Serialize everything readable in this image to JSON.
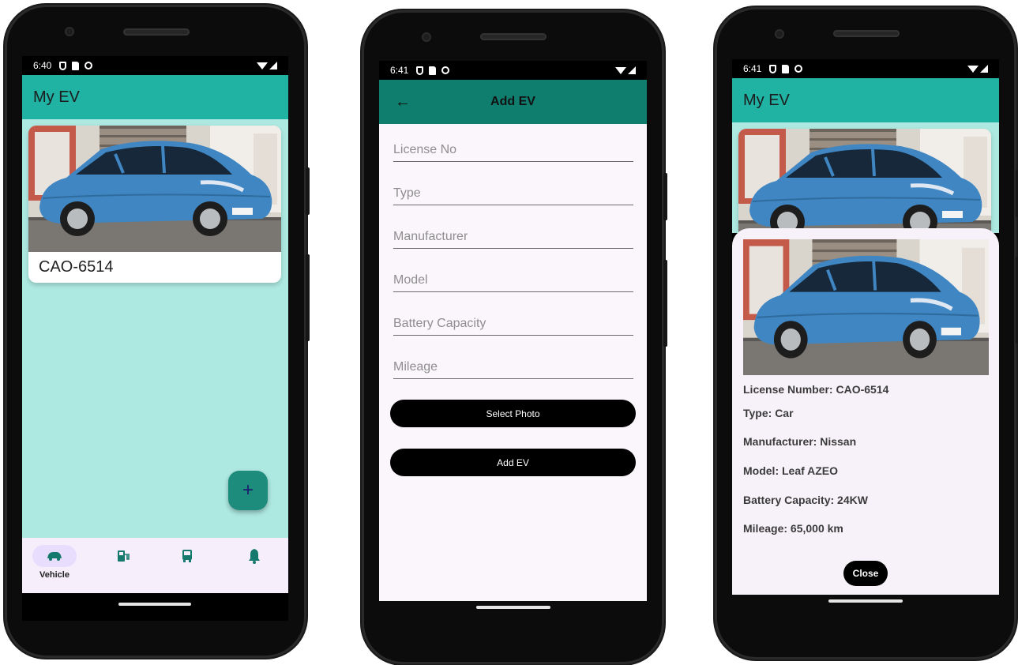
{
  "colors": {
    "appbar_teal": "#20b2a3",
    "appbar_dark_teal": "#107e6f",
    "list_background": "#ade8e1",
    "form_background": "#fbf5fc",
    "fab": "#1e8c7c",
    "nav_bar": "#f6eefa",
    "nav_selected_pill": "#e8ddfc",
    "nav_icon": "#157a6d"
  },
  "screen1": {
    "status": {
      "time": "6:40"
    },
    "app_title": "My EV",
    "vehicle_card": {
      "plate": "CAO-6514",
      "image": "car-photo"
    },
    "fab_symbol": "+",
    "bottom_nav": [
      {
        "icon": "car-icon",
        "label": "Vehicle",
        "selected": true
      },
      {
        "icon": "ev-station-icon",
        "label": "",
        "selected": false
      },
      {
        "icon": "bus-icon",
        "label": "",
        "selected": false
      },
      {
        "icon": "bell-icon",
        "label": "",
        "selected": false
      }
    ]
  },
  "screen2": {
    "status": {
      "time": "6:41"
    },
    "back_symbol": "←",
    "title": "Add EV",
    "fields": {
      "license": "License No",
      "type": "Type",
      "manufacturer": "Manufacturer",
      "model": "Model",
      "battery": "Battery Capacity",
      "mileage": "Mileage"
    },
    "select_photo_label": "Select Photo",
    "add_ev_label": "Add EV"
  },
  "screen3": {
    "status": {
      "time": "6:41"
    },
    "app_title": "My EV",
    "details": {
      "license": "License Number: CAO-6514",
      "type": "Type: Car",
      "manufacturer": "Manufacturer: Nissan",
      "model": "Model: Leaf AZEO",
      "battery": "Battery Capacity: 24KW",
      "mileage": "Mileage: 65,000 km"
    },
    "close_label": "Close"
  }
}
